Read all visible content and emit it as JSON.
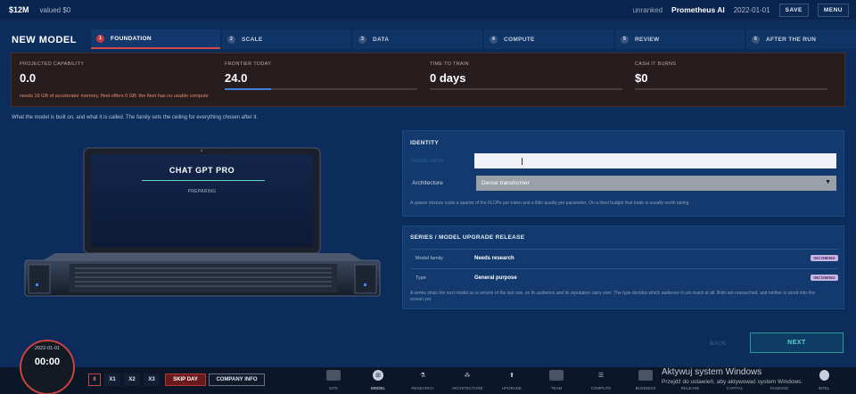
{
  "topbar": {
    "cash": "$12M",
    "valued": "valued $0",
    "rank": "unranked",
    "company": "Prometheus AI",
    "date": "2022-01-01",
    "save_label": "SAVE",
    "menu_label": "MENU"
  },
  "page": {
    "title": "NEW MODEL",
    "description": "What the model is built on, and what it is called. The family sets the ceiling for everything chosen after it."
  },
  "steps": [
    {
      "num": "1",
      "label": "FOUNDATION"
    },
    {
      "num": "2",
      "label": "SCALE"
    },
    {
      "num": "3",
      "label": "DATA"
    },
    {
      "num": "4",
      "label": "COMPUTE"
    },
    {
      "num": "5",
      "label": "REVIEW"
    },
    {
      "num": "6",
      "label": "AFTER THE RUN"
    }
  ],
  "stats": {
    "capability": {
      "label": "PROJECTED CAPABILITY",
      "value": "0.0"
    },
    "frontier": {
      "label": "FRONTIER TODAY",
      "value": "24.0",
      "bar_fill": 0.24
    },
    "time": {
      "label": "TIME TO TRAIN",
      "value": "0 days"
    },
    "cost": {
      "label": "CASH IT BURNS",
      "value": "$0"
    },
    "warning": "needs 16 GB of accelerator memory, fleet offers 0 GB: the fleet has no usable compute"
  },
  "laptop": {
    "screen_title": "CHAT GPT PRO",
    "screen_status": "PREPARING"
  },
  "identity": {
    "title": "IDENTITY",
    "name_label": "Model name",
    "name_value": "",
    "arch_label": "Architecture",
    "arch_value": "Dense transformer",
    "hint": "A sparse mixture costs a quarter of the FLOPs per token and a little quality per parameter. On a fixed budget that trade is usually worth taking."
  },
  "series": {
    "title": "SERIES / MODEL UPGRADE RELEASE",
    "rows": [
      {
        "label": "Model family",
        "value": "Needs research",
        "badge": "INCOMING"
      },
      {
        "label": "Type",
        "value": "General purpose",
        "badge": "INCOMING"
      }
    ],
    "hint": "A series ships the next model as a version of the last one, so its audience and its reputation carry over. The type decides which audience it can reach at all. Both are researched, and neither is wired into this screen yet."
  },
  "nav": {
    "back_label": "BACK",
    "next_label": "NEXT"
  },
  "clock": {
    "date": "2022-01-01",
    "time": "00:00"
  },
  "controls": {
    "pause": "II",
    "x1": "X1",
    "x2": "X2",
    "x3": "X3",
    "skip": "SKIP DAY",
    "company_info": "COMPANY INFO"
  },
  "tabs": [
    {
      "label": "SITE",
      "icon": "site-icon"
    },
    {
      "label": "MODEL",
      "icon": "model-icon",
      "active": true
    },
    {
      "label": "RESEARCH",
      "icon": "microscope-icon"
    },
    {
      "label": "ARCHITECTURE",
      "icon": "architecture-icon"
    },
    {
      "label": "UPGRADE",
      "icon": "upgrade-icon"
    },
    {
      "label": "TEAM",
      "icon": "team-icon"
    },
    {
      "label": "COMPUTE",
      "icon": "server-icon"
    },
    {
      "label": "BUSINESS",
      "icon": "briefcase-icon"
    },
    {
      "label": "RELEASE",
      "icon": "release-icon"
    },
    {
      "label": "CAPITAL",
      "icon": "capital-icon"
    },
    {
      "label": "RANKING",
      "icon": "ranking-icon"
    },
    {
      "label": "INTEL",
      "icon": "intel-icon"
    }
  ],
  "watermark": {
    "line1": "Aktywuj system Windows",
    "line2": "Przejdź do ustawień, aby aktywować system Windows."
  }
}
